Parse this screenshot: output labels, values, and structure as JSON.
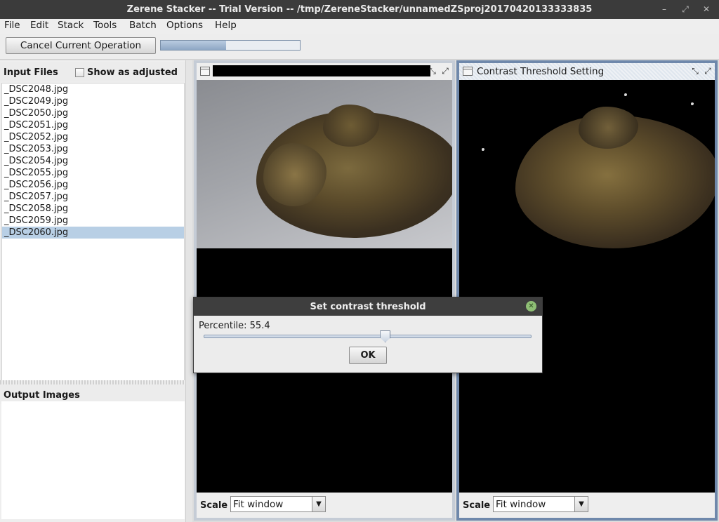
{
  "window": {
    "title": "Zerene Stacker -- Trial Version -- /tmp/ZereneStacker/unnamedZSproj20170420133333835",
    "controls": [
      "–",
      "⤢",
      "✕"
    ]
  },
  "menu": [
    "File",
    "Edit",
    "Stack",
    "Tools",
    "Batch",
    "Options",
    "Help"
  ],
  "toolbar": {
    "cancel_label": "Cancel Current Operation",
    "progress_fraction": 0.47
  },
  "input_panel": {
    "title": "Input Files",
    "show_adjusted_label": "Show as adjusted",
    "files": [
      "_DSC2048.jpg",
      "_DSC2049.jpg",
      "_DSC2050.jpg",
      "_DSC2051.jpg",
      "_DSC2052.jpg",
      "_DSC2053.jpg",
      "_DSC2054.jpg",
      "_DSC2055.jpg",
      "_DSC2056.jpg",
      "_DSC2057.jpg",
      "_DSC2058.jpg",
      "_DSC2059.jpg",
      "_DSC2060.jpg"
    ],
    "selected_index": 12
  },
  "output_panel": {
    "title": "Output Images"
  },
  "left_frame": {
    "scale_label": "Scale",
    "scale_value": "Fit window"
  },
  "right_frame": {
    "title": "Contrast Threshold Setting",
    "scale_label": "Scale",
    "scale_value": "Fit window"
  },
  "dialog": {
    "title": "Set contrast threshold",
    "percentile_label": "Percentile: 55.4",
    "percentile_value": 55.4,
    "ok_label": "OK"
  },
  "colors": {
    "titlebar": "#3b3b3b",
    "selection": "#b8cfe5",
    "active_frame_border": "#6f88ab"
  }
}
